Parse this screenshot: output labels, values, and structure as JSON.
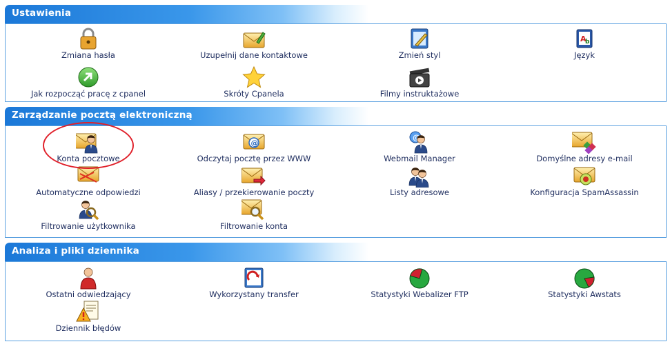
{
  "sections": [
    {
      "title": "Ustawienia",
      "items": [
        {
          "label": "Zmiana hasła",
          "icon": "padlock-icon"
        },
        {
          "label": "Uzupełnij dane kontaktowe",
          "icon": "envelope-contact-icon"
        },
        {
          "label": "Zmień styl",
          "icon": "paint-style-icon"
        },
        {
          "label": "Język",
          "icon": "language-icon"
        },
        {
          "label": "Jak rozpocząć pracę z cpanel",
          "icon": "start-arrow-icon"
        },
        {
          "label": "Skróty Cpanela",
          "icon": "star-icon"
        },
        {
          "label": "Filmy instruktażowe",
          "icon": "film-icon"
        }
      ]
    },
    {
      "title": "Zarządzanie pocztą elektroniczną",
      "items": [
        {
          "label": "Konta pocztowe",
          "icon": "mail-account-icon"
        },
        {
          "label": "Odczytaj pocztę przez WWW",
          "icon": "webmail-icon"
        },
        {
          "label": "Webmail Manager",
          "icon": "webmail-manager-icon"
        },
        {
          "label": "Domyślne adresy e-mail",
          "icon": "default-address-icon"
        },
        {
          "label": "Automatyczne odpowiedzi",
          "icon": "autoresponder-icon"
        },
        {
          "label": "Aliasy / przekierowanie poczty",
          "icon": "forwarder-icon"
        },
        {
          "label": "Listy adresowe",
          "icon": "mailing-list-icon"
        },
        {
          "label": "Konfiguracja SpamAssassin",
          "icon": "spam-icon"
        },
        {
          "label": "Filtrowanie użytkownika",
          "icon": "user-filter-icon"
        },
        {
          "label": "Filtrowanie konta",
          "icon": "account-filter-icon"
        }
      ]
    },
    {
      "title": "Analiza i pliki dziennika",
      "items": [
        {
          "label": "Ostatni odwiedzający",
          "icon": "latest-visitors-icon"
        },
        {
          "label": "Wykorzystany transfer",
          "icon": "bandwidth-icon"
        },
        {
          "label": "Statystyki Webalizer FTP",
          "icon": "webalizer-pie-icon"
        },
        {
          "label": "Statystyki Awstats",
          "icon": "awstats-pie-icon"
        },
        {
          "label": "Dziennik błędów",
          "icon": "error-log-icon"
        }
      ]
    }
  ],
  "colors": {
    "header_blue": "#1b78d8",
    "border": "#5aa0e0",
    "highlight_circle": "#e0202a"
  }
}
